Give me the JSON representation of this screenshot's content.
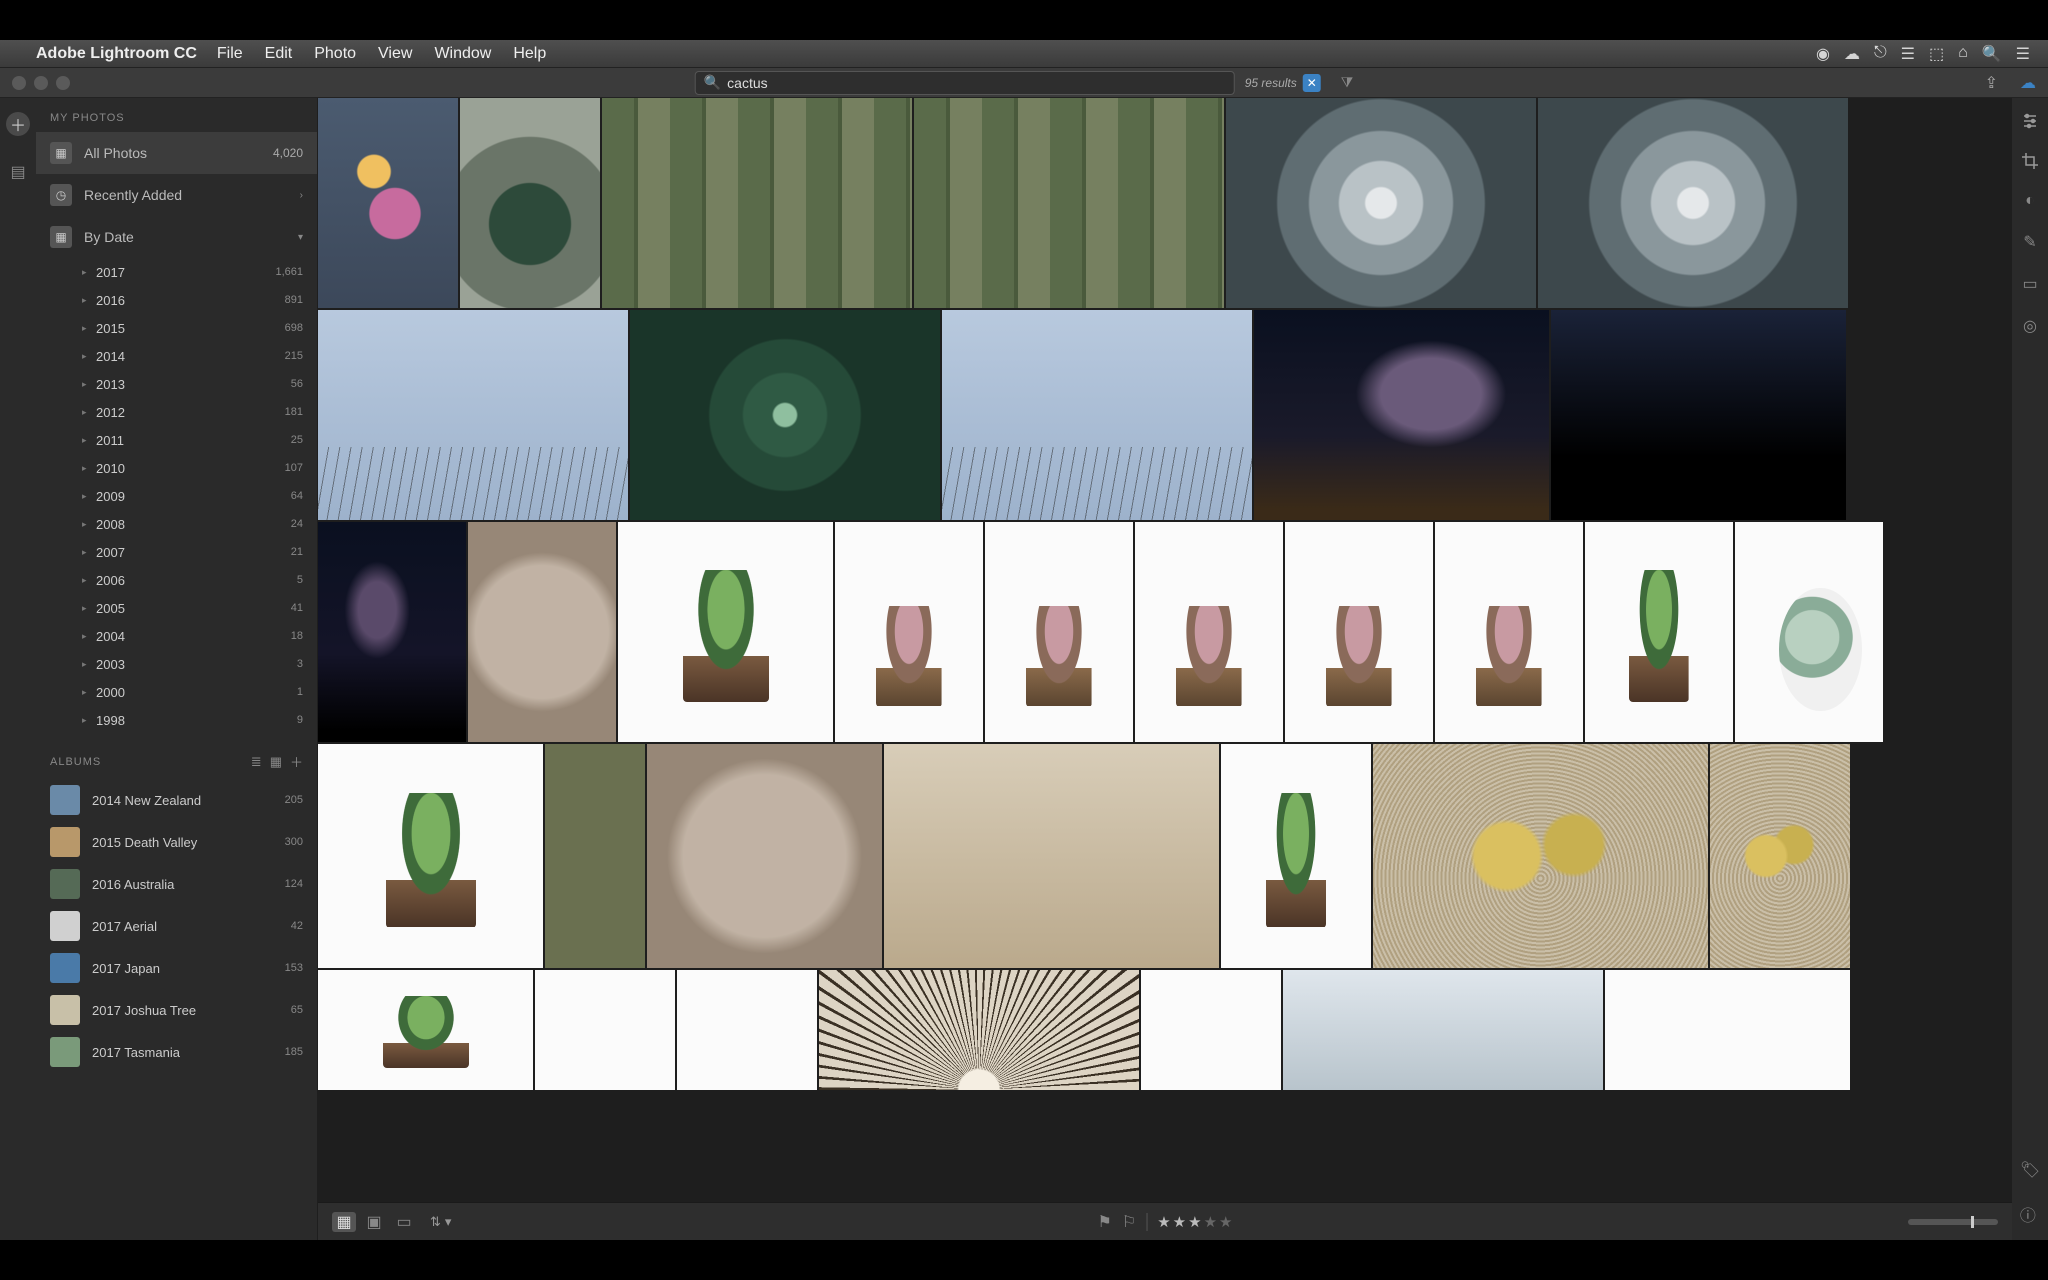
{
  "menubar": {
    "app_name": "Adobe Lightroom CC",
    "items": [
      "File",
      "Edit",
      "Photo",
      "View",
      "Window",
      "Help"
    ]
  },
  "search": {
    "query": "cactus",
    "results_label": "95 results"
  },
  "sidebar": {
    "section_title": "MY PHOTOS",
    "all_photos": {
      "label": "All Photos",
      "count": "4,020"
    },
    "recently_added": {
      "label": "Recently Added"
    },
    "by_date": {
      "label": "By Date"
    },
    "years": [
      {
        "year": "2017",
        "count": "1,661"
      },
      {
        "year": "2016",
        "count": "891"
      },
      {
        "year": "2015",
        "count": "698"
      },
      {
        "year": "2014",
        "count": "215"
      },
      {
        "year": "2013",
        "count": "56"
      },
      {
        "year": "2012",
        "count": "181"
      },
      {
        "year": "2011",
        "count": "25"
      },
      {
        "year": "2010",
        "count": "107"
      },
      {
        "year": "2009",
        "count": "64"
      },
      {
        "year": "2008",
        "count": "24"
      },
      {
        "year": "2007",
        "count": "21"
      },
      {
        "year": "2006",
        "count": "5"
      },
      {
        "year": "2005",
        "count": "41"
      },
      {
        "year": "2004",
        "count": "18"
      },
      {
        "year": "2003",
        "count": "3"
      },
      {
        "year": "2000",
        "count": "1"
      },
      {
        "year": "1998",
        "count": "9"
      }
    ]
  },
  "albums": {
    "title": "ALBUMS",
    "items": [
      {
        "name": "2014 New Zealand",
        "count": "205"
      },
      {
        "name": "2015 Death Valley",
        "count": "300"
      },
      {
        "name": "2016 Australia",
        "count": "124"
      },
      {
        "name": "2017 Aerial",
        "count": "42"
      },
      {
        "name": "2017 Japan",
        "count": "153"
      },
      {
        "name": "2017 Joshua Tree",
        "count": "65"
      },
      {
        "name": "2017 Tasmania",
        "count": "185"
      }
    ]
  },
  "footer": {
    "rating_value": 3
  }
}
